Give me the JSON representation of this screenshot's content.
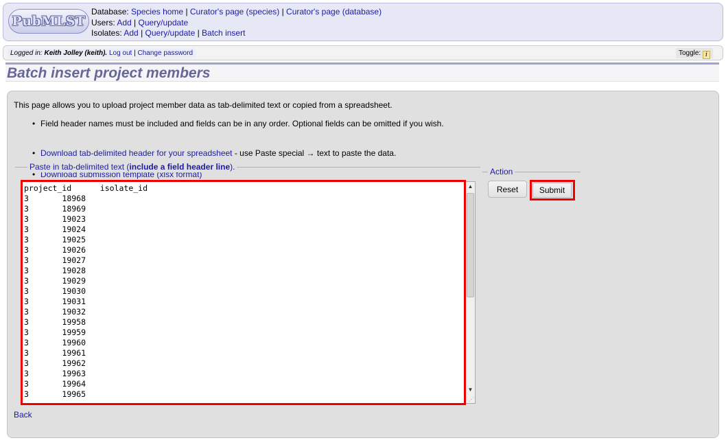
{
  "header": {
    "logo_text": "PubMLST",
    "database_label": "Database:",
    "database_links": [
      "Species home",
      "Curator's page (species)",
      "Curator's page (database)"
    ],
    "users_label": "Users:",
    "users_links": [
      "Add",
      "Query/update"
    ],
    "isolates_label": "Isolates:",
    "isolates_links": [
      "Add",
      "Query/update",
      "Batch insert"
    ],
    "separator": "|"
  },
  "login": {
    "prefix": "Logged in:",
    "user": "Keith Jolley (keith).",
    "logout": "Log out",
    "change_password": "Change password",
    "toggle_label": "Toggle:",
    "toggle_icon": "i"
  },
  "page_title": "Batch insert project members",
  "intro": "This page allows you to upload project member data as tab-delimited text or copied from a spreadsheet.",
  "bullets": {
    "field_headers": "Field header names must be included and fields can be in any order. Optional fields can be omitted if you wish.",
    "download_header_link": "Download tab-delimited header for your spreadsheet",
    "download_header_suffix": " - use Paste special → text to paste the data.",
    "download_template_link": "Download submission template (xlsx format)"
  },
  "paste_fieldset": {
    "legend_prefix": "Paste in tab-delimited text (",
    "legend_bold": "include a field header line",
    "legend_suffix": ")."
  },
  "textarea_value": "project_id\tisolate_id\n3\t18968\n3\t18969\n3\t19023\n3\t19024\n3\t19025\n3\t19026\n3\t19027\n3\t19028\n3\t19029\n3\t19030\n3\t19031\n3\t19032\n3\t19958\n3\t19959\n3\t19960\n3\t19961\n3\t19962\n3\t19963\n3\t19964\n3\t19965",
  "action": {
    "legend": "Action",
    "reset": "Reset",
    "submit": "Submit"
  },
  "back": "Back",
  "colors": {
    "highlight": "#ee0000",
    "title": "#666699",
    "link": "#1a1aa6"
  }
}
